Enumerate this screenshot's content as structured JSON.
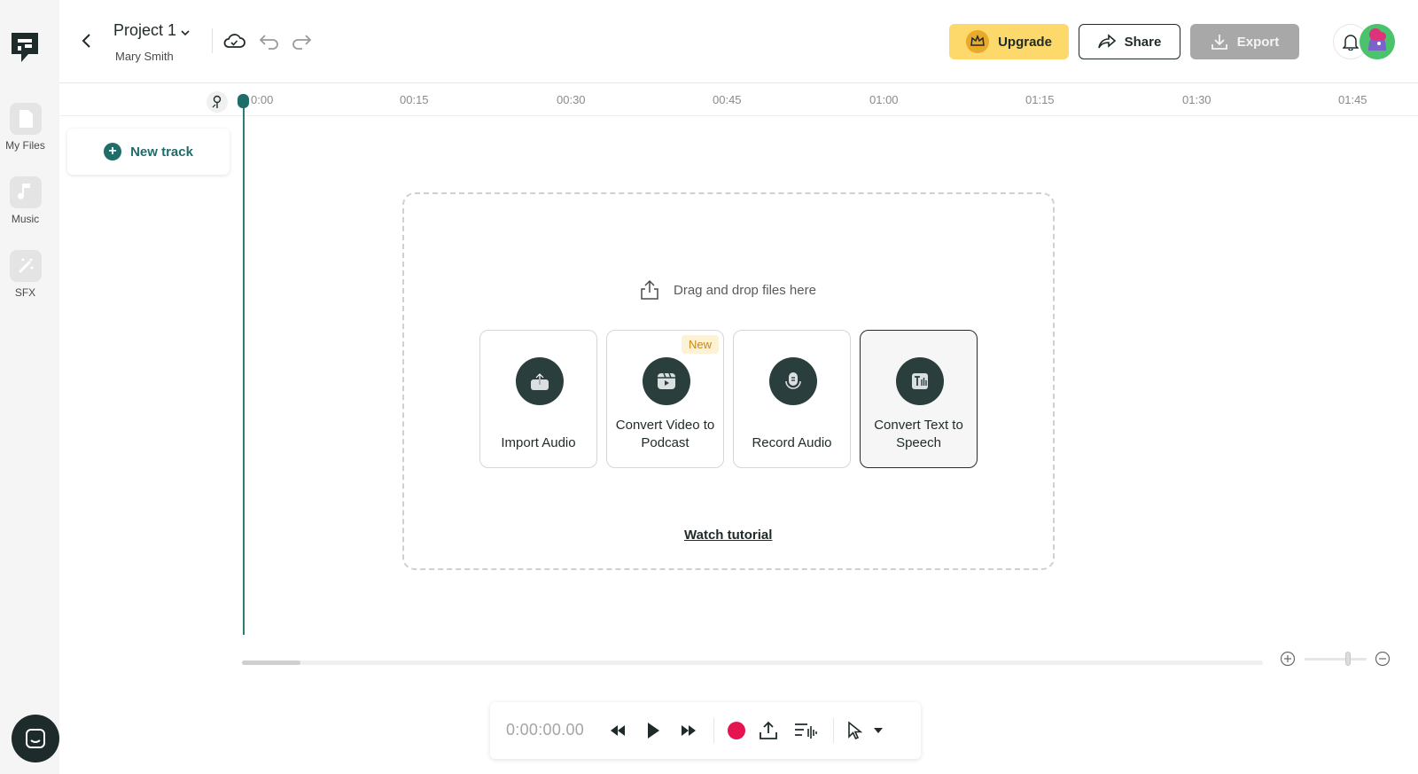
{
  "app": {
    "sidebar": {
      "items": [
        {
          "label": "My Files",
          "icon": "file-icon"
        },
        {
          "label": "Music",
          "icon": "music-note-icon"
        },
        {
          "label": "SFX",
          "icon": "magic-wand-icon"
        }
      ]
    },
    "header": {
      "project_title": "Project 1",
      "user_name": "Mary Smith",
      "upgrade_label": "Upgrade",
      "share_label": "Share",
      "export_label": "Export"
    },
    "timeline": {
      "ticks": [
        "0:00",
        "00:15",
        "00:30",
        "00:45",
        "01:00",
        "01:15",
        "01:30",
        "01:45"
      ],
      "new_track_label": "New track"
    },
    "dropzone": {
      "drag_text": "Drag and drop files here",
      "cards": [
        {
          "label": "Import Audio",
          "icon": "upload-icon"
        },
        {
          "label": "Convert Video to Podcast",
          "icon": "video-icon",
          "badge": "New"
        },
        {
          "label": "Record Audio",
          "icon": "microphone-icon"
        },
        {
          "label": "Convert Text to Speech",
          "icon": "text-to-speech-icon"
        }
      ],
      "watch_tutorial": "Watch tutorial"
    },
    "transport": {
      "time": "0:00:00.00"
    },
    "colors": {
      "accent": "#1e6d69",
      "upgrade": "#fcd96a",
      "record": "#e5134f",
      "export_disabled": "#a8a8a8"
    }
  }
}
